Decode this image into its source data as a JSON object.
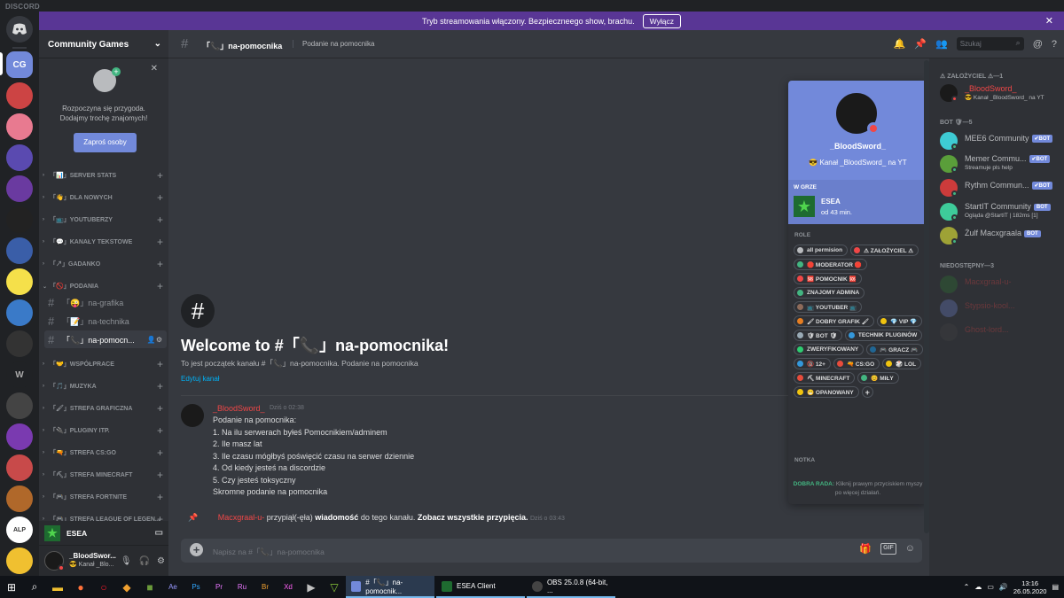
{
  "app_title": "DISCORD",
  "banner": {
    "text": "Tryb streamowania włączony. Bezpieczneego show, brachu.",
    "button": "Wyłącz",
    "close": "✕"
  },
  "guilds": {
    "home_label": "",
    "selected_label": "CG"
  },
  "server": {
    "name": "Community Games"
  },
  "invite": {
    "close": "✕",
    "message_line1": "Rozpoczyna się przygoda.",
    "message_line2": "Dodajmy trochę znajomych!",
    "button": "Zaproś osoby"
  },
  "categories": [
    {
      "label": "「📊」SERVER STATS"
    },
    {
      "label": "「👋」DLA NOWYCH"
    },
    {
      "label": "「📺」YOUTUBERZY"
    },
    {
      "label": "「💬」KANAŁY TEKSTOWE"
    },
    {
      "label": "「↗」GADANKO"
    },
    {
      "label": "「🚫」PODANIA"
    },
    {
      "label": "「🤝」WSPÓŁPRACE"
    },
    {
      "label": "「🎵」MUZYKA"
    },
    {
      "label": "「🖌」STREFA GRAFICZNA"
    },
    {
      "label": "「🔌」PLUGINY ITP."
    },
    {
      "label": "「🔫」STREFA CS:GO"
    },
    {
      "label": "「⛏」STREFA MINECRAFT"
    },
    {
      "label": "「🎮」STREFA FORTNITE"
    },
    {
      "label": "「🎮」STREFA LEAGUE OF LEGEN..."
    }
  ],
  "channels": [
    {
      "label": "「😜」na-grafika"
    },
    {
      "label": "「📝」na-technika"
    },
    {
      "label": "「📞」na-pomocn..."
    }
  ],
  "voice": {
    "label": "ESEA"
  },
  "user": {
    "name": "_BloodSwor...",
    "status": "😎 Kanał _Blo..."
  },
  "header": {
    "channel": "「📞」na-pomocnika",
    "topic": "Podanie na pomocnika",
    "search_placeholder": "Szukaj"
  },
  "welcome": {
    "title": "Welcome to #「📞」na-pomocnika!",
    "subtitle": "To jest początek kanału #「📞」na-pomocnika. Podanie na pomocnika",
    "edit": "Edytuj kanał"
  },
  "message": {
    "author": "_BloodSword_",
    "time": "Dziś o 02:38",
    "lines": [
      "Podanie na pomocnika:",
      "1. Na ilu serwerach byłeś Pomocnikiem/adminem",
      "2. Ile masz lat",
      "3. Ile czasu mógłbyś poświęcić czasu na serwer dziennie",
      "4. Od kiedy jesteś na discordzie",
      "5. Czy jesteś toksyczny",
      "Skromne podanie na pomocnika"
    ]
  },
  "pin_notice": {
    "author": "Macxgraal-u-",
    "text1": "przypiął(-ęła)",
    "bold1": "wiadomość",
    "text2": "do tego kanału.",
    "bold2": "Zobacz wszystkie przypięcia.",
    "time": "Dziś o 03:43"
  },
  "composer": {
    "placeholder": "Napisz na #「📞」na-pomocnika"
  },
  "profile": {
    "name": "_BloodSword_",
    "status": "😎 Kanał _BloodSword_ na YT",
    "game_label": "W GRZE",
    "game_name": "ESEA",
    "game_time": "od 43 min.",
    "roles_label": "ROLE",
    "roles": [
      {
        "name": "all permision",
        "color": "#b9bbbe"
      },
      {
        "name": "⚠ ZAŁOŻYCIEL ⚠",
        "color": "#f04747"
      },
      {
        "name": "🛑 MODERATOR 🛑",
        "color": "#43b581"
      },
      {
        "name": "🆘 POMOCNIK 🆘",
        "color": "#f04747"
      },
      {
        "name": "ZNAJOMY ADMINA",
        "color": "#43b581"
      },
      {
        "name": "📺 YOUTUBER 📺",
        "color": "#8e6b5a"
      },
      {
        "name": "🖌 DOBRY GRAFIK 🖌",
        "color": "#e67e22"
      },
      {
        "name": "💎 VIP 💎",
        "color": "#f1c40f"
      },
      {
        "name": "🛡 BOT 🛡",
        "color": "#99aab5"
      },
      {
        "name": "TECHNIK PLUGINÓW",
        "color": "#3498db"
      },
      {
        "name": "ZWERYFIKOWANY",
        "color": "#2ecc71"
      },
      {
        "name": "🎮 GRACZ 🎮",
        "color": "#206694"
      },
      {
        "name": "🔞 12+",
        "color": "#3498db"
      },
      {
        "name": "🔫 CS:GO",
        "color": "#e74c3c"
      },
      {
        "name": "🎲 LOL",
        "color": "#f1c40f"
      },
      {
        "name": "⛏ MINECRAFT",
        "color": "#e74c3c"
      },
      {
        "name": "😊 MIŁY",
        "color": "#43b581"
      },
      {
        "name": "😁 OPANOWANY",
        "color": "#f1c40f"
      }
    ],
    "add_role": "+",
    "note_label": "NOTKA",
    "tip_bold": "DOBRA RADA:",
    "tip_text": "Kliknij prawym przyciskiem myszy po więcej działań."
  },
  "members": {
    "groups": [
      {
        "label": "⚠ ZAŁOŻYCIEL ⚠—1"
      },
      {
        "label": "BOT 🛡—5"
      },
      {
        "label": "NIEDOSTĘPNY—3"
      }
    ],
    "founder": {
      "name": "_BloodSword_",
      "status": "😎 Kanał _BloodSword_ na YT"
    },
    "bots": [
      {
        "name": "MEE6 Community",
        "status": "",
        "tag": "✔BOT",
        "color": "#3ecbd4"
      },
      {
        "name": "Memer Commu...",
        "status": "Streamuje pls help",
        "tag": "✔BOT",
        "color": "#5a9e3a"
      },
      {
        "name": "Rythm Commun...",
        "status": "",
        "tag": "✔BOT",
        "color": "#cc3b3b"
      },
      {
        "name": "StartIT Community",
        "status": "Ogląda @StartIT | 182ms [1]",
        "tag": "BOT",
        "color": "#3ecb9a"
      },
      {
        "name": "Żulf Macxgraala",
        "status": "",
        "tag": "BOT",
        "color": "#9ea236"
      }
    ],
    "offline": [
      {
        "name": "Macxgraal-u-",
        "color": "#2e7d32"
      },
      {
        "name": "Stypsio-kool...",
        "color": "#7289da"
      },
      {
        "name": "Ghost-lord...",
        "color": "#444"
      }
    ]
  },
  "taskbar": {
    "apps": [
      {
        "label": "#「📞」na-pomocnik...",
        "color": "#7289da"
      },
      {
        "label": "ESEA Client",
        "color": "#1e6b30"
      },
      {
        "label": "OBS 25.0.8 (64-bit, ...",
        "color": "#444"
      }
    ],
    "time": "13:16",
    "date": "26.05.2020"
  }
}
